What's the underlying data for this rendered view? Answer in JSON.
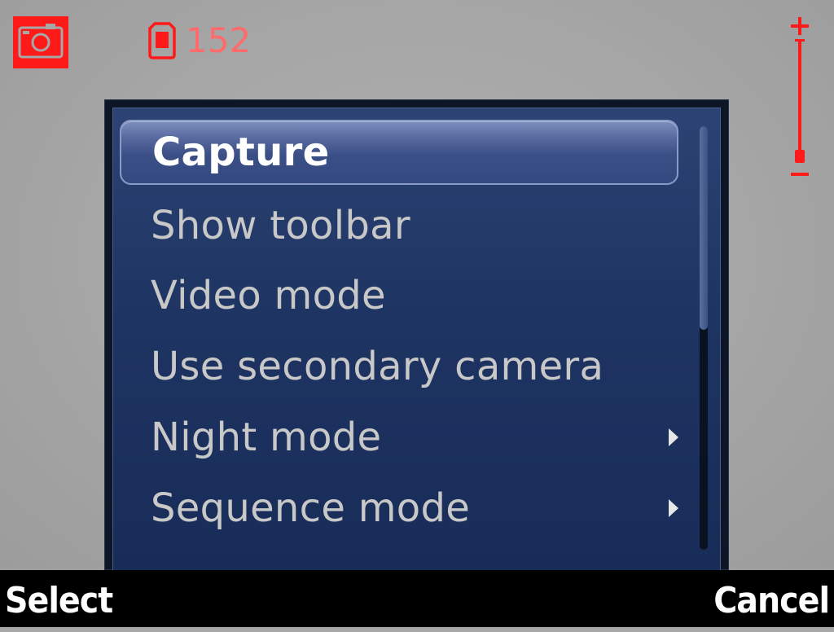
{
  "status": {
    "camera_icon": "camera-icon",
    "memory_icon": "memory-card-icon",
    "images_remaining": "152"
  },
  "zoom": {
    "plus_label": "+",
    "minus_label": "−",
    "level": 0
  },
  "menu": {
    "items": [
      {
        "label": "Capture",
        "selected": true,
        "has_submenu": false
      },
      {
        "label": "Show toolbar",
        "selected": false,
        "has_submenu": false
      },
      {
        "label": "Video mode",
        "selected": false,
        "has_submenu": false
      },
      {
        "label": "Use secondary camera",
        "selected": false,
        "has_submenu": false
      },
      {
        "label": "Night mode",
        "selected": false,
        "has_submenu": true
      },
      {
        "label": "Sequence mode",
        "selected": false,
        "has_submenu": true
      }
    ]
  },
  "softkeys": {
    "left": "Select",
    "right": "Cancel"
  },
  "colors": {
    "indicator_red": "#ff1a1a",
    "menu_bg": "#1e3462",
    "highlight": "#56689e"
  }
}
